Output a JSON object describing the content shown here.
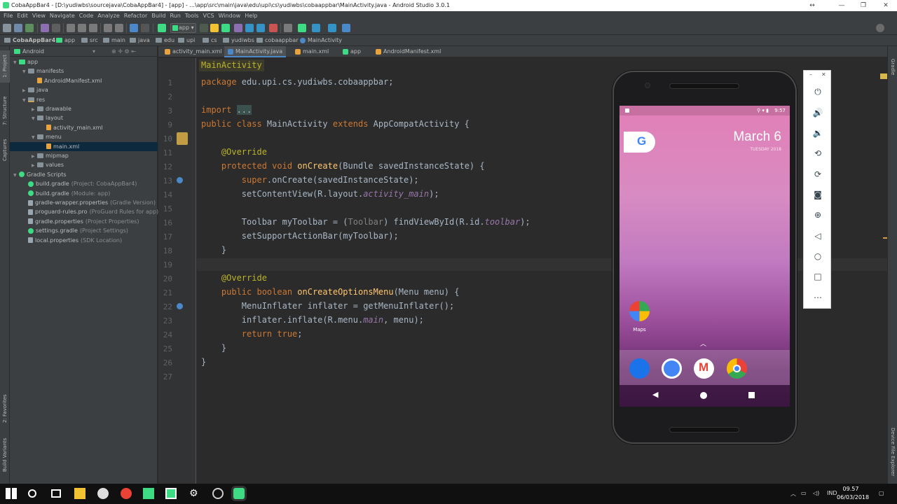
{
  "window": {
    "title": "CobaAppBar4 - [D:\\yudiwbs\\sourcejava\\CobaAppBar4] - [app] - ...\\app\\src\\main\\java\\edu\\upi\\cs\\yudiwbs\\cobaappbar\\MainActivity.java - Android Studio 3.0.1"
  },
  "menu": [
    "File",
    "Edit",
    "View",
    "Navigate",
    "Code",
    "Analyze",
    "Refactor",
    "Build",
    "Run",
    "Tools",
    "VCS",
    "Window",
    "Help"
  ],
  "toolbar": {
    "run_config": "app"
  },
  "breadcrumb": [
    "CobaAppBar4",
    "app",
    "src",
    "main",
    "java",
    "edu",
    "upi",
    "cs",
    "yudiwbs",
    "cobaappbar",
    "MainActivity"
  ],
  "project_panel": {
    "view_mode": "Android",
    "tree": [
      {
        "label": "app",
        "hint": "",
        "arrow": "▼",
        "icon": "app",
        "indent": 0
      },
      {
        "label": "manifests",
        "hint": "",
        "arrow": "▼",
        "icon": "folder",
        "indent": 1
      },
      {
        "label": "AndroidManifest.xml",
        "hint": "",
        "arrow": "",
        "icon": "xml",
        "indent": 2
      },
      {
        "label": "java",
        "hint": "",
        "arrow": "▶",
        "icon": "folder",
        "indent": 1
      },
      {
        "label": "res",
        "hint": "",
        "arrow": "▼",
        "icon": "res",
        "indent": 1
      },
      {
        "label": "drawable",
        "hint": "",
        "arrow": "▶",
        "icon": "folder",
        "indent": 2
      },
      {
        "label": "layout",
        "hint": "",
        "arrow": "▼",
        "icon": "folder",
        "indent": 2
      },
      {
        "label": "activity_main.xml",
        "hint": "",
        "arrow": "",
        "icon": "xml",
        "indent": 3
      },
      {
        "label": "menu",
        "hint": "",
        "arrow": "▼",
        "icon": "folder",
        "indent": 2
      },
      {
        "label": "main.xml",
        "hint": "",
        "arrow": "",
        "icon": "xml",
        "indent": 3,
        "selected": true
      },
      {
        "label": "mipmap",
        "hint": "",
        "arrow": "▶",
        "icon": "folder",
        "indent": 2
      },
      {
        "label": "values",
        "hint": "",
        "arrow": "▶",
        "icon": "folder",
        "indent": 2
      },
      {
        "label": "Gradle Scripts",
        "hint": "",
        "arrow": "▼",
        "icon": "gradle",
        "indent": 0
      },
      {
        "label": "build.gradle",
        "hint": "(Project: CobaAppBar4)",
        "arrow": "",
        "icon": "gradle",
        "indent": 1
      },
      {
        "label": "build.gradle",
        "hint": "(Module: app)",
        "arrow": "",
        "icon": "gradle",
        "indent": 1
      },
      {
        "label": "gradle-wrapper.properties",
        "hint": "(Gradle Version)",
        "arrow": "",
        "icon": "file",
        "indent": 1
      },
      {
        "label": "proguard-rules.pro",
        "hint": "(ProGuard Rules for app)",
        "arrow": "",
        "icon": "file",
        "indent": 1
      },
      {
        "label": "gradle.properties",
        "hint": "(Project Properties)",
        "arrow": "",
        "icon": "file",
        "indent": 1
      },
      {
        "label": "settings.gradle",
        "hint": "(Project Settings)",
        "arrow": "",
        "icon": "gradle",
        "indent": 1
      },
      {
        "label": "local.properties",
        "hint": "(SDK Location)",
        "arrow": "",
        "icon": "file",
        "indent": 1
      }
    ]
  },
  "left_tool_tabs": [
    "1: Project",
    "7: Structure",
    "Captures",
    "2: Favorites",
    "Build Variants"
  ],
  "right_tool_tabs": [
    "Gradle",
    "Device File Explorer"
  ],
  "editor_tabs": [
    {
      "label": "activity_main.xml",
      "active": false,
      "color": "#e8a33d"
    },
    {
      "label": "MainActivity.java",
      "active": true,
      "color": "#4a88c7"
    },
    {
      "label": "main.xml",
      "active": false,
      "color": "#e8a33d"
    },
    {
      "label": "app",
      "active": false,
      "color": "#3ddc84"
    },
    {
      "label": "AndroidManifest.xml",
      "active": false,
      "color": "#e8a33d"
    }
  ],
  "editor": {
    "class_crumb": "MainActivity",
    "line_numbers": [
      "1",
      "2",
      "3",
      "9",
      "10",
      "11",
      "12",
      "13",
      "14",
      "15",
      "16",
      "17",
      "18",
      "19",
      "20",
      "21",
      "22",
      "23",
      "24",
      "25",
      "26",
      "27"
    ],
    "lines": [
      [
        [
          "kw",
          "package "
        ],
        [
          "",
          "edu.upi.cs.yudiwbs.cobaappbar;"
        ]
      ],
      [],
      [
        [
          "kw",
          "import "
        ],
        [
          "fold",
          "..."
        ]
      ],
      [
        [
          "kw",
          "public class "
        ],
        [
          "",
          "MainActivity "
        ],
        [
          "kw",
          "extends "
        ],
        [
          "",
          "AppCompatActivity {"
        ]
      ],
      [],
      [
        [
          "an",
          "    @Override"
        ]
      ],
      [
        [
          "kw",
          "    protected void "
        ],
        [
          "fn",
          "onCreate"
        ],
        [
          "",
          "(Bundle savedInstanceState) {"
        ]
      ],
      [
        [
          "kw",
          "        super"
        ],
        [
          "",
          ".onCreate(savedInstanceState);"
        ]
      ],
      [
        [
          "",
          "        setContentView(R.layout."
        ],
        [
          "it",
          "activity_main"
        ],
        [
          "",
          ");"
        ]
      ],
      [],
      [
        [
          "",
          "        Toolbar myToolbar = ("
        ],
        [
          "grey",
          "Toolbar"
        ],
        [
          "",
          ") findViewById(R.id."
        ],
        [
          "it",
          "toolbar"
        ],
        [
          "",
          ");"
        ]
      ],
      [
        [
          "",
          "        setSupportActionBar(myToolbar);"
        ]
      ],
      [
        [
          "",
          "    }"
        ]
      ],
      [],
      [
        [
          "an",
          "    @Override"
        ]
      ],
      [
        [
          "kw",
          "    public boolean "
        ],
        [
          "fn",
          "onCreateOptionsMenu"
        ],
        [
          "",
          "(Menu menu) {"
        ]
      ],
      [
        [
          "",
          "        MenuInflater inflater = getMenuInflater();"
        ]
      ],
      [
        [
          "",
          "        inflater.inflate(R.menu."
        ],
        [
          "it",
          "main"
        ],
        [
          "",
          ", menu);"
        ]
      ],
      [
        [
          "kw",
          "        return true"
        ],
        [
          "",
          ";"
        ]
      ],
      [
        [
          "",
          "    }"
        ]
      ],
      [
        [
          "",
          "}"
        ]
      ],
      []
    ]
  },
  "emulator": {
    "status_time": "9:57",
    "date_big": "March 6",
    "date_small": "TUESDAY 2018",
    "google_letter": "G",
    "maps_label": "Maps",
    "dock_colors": [
      "#1a73e8",
      "#4285f4",
      "#ffffff",
      "#ea4335"
    ],
    "panel_buttons": [
      "power-icon",
      "volume-up-icon",
      "volume-down-icon",
      "rotate-left-icon",
      "rotate-right-icon",
      "camera-icon",
      "zoom-icon",
      "back-icon",
      "home-icon",
      "overview-icon",
      "more-icon"
    ]
  },
  "taskbar": {
    "language": "IND",
    "time": "09.57",
    "date": "06/03/2018"
  },
  "colors": {
    "ide_bg": "#2b2b2b",
    "panel_bg": "#3c3f41",
    "keyword": "#cc7832",
    "annotation": "#bbb529",
    "method": "#ffc66d",
    "field_italic": "#9876aa",
    "android_green": "#3ddc84"
  }
}
